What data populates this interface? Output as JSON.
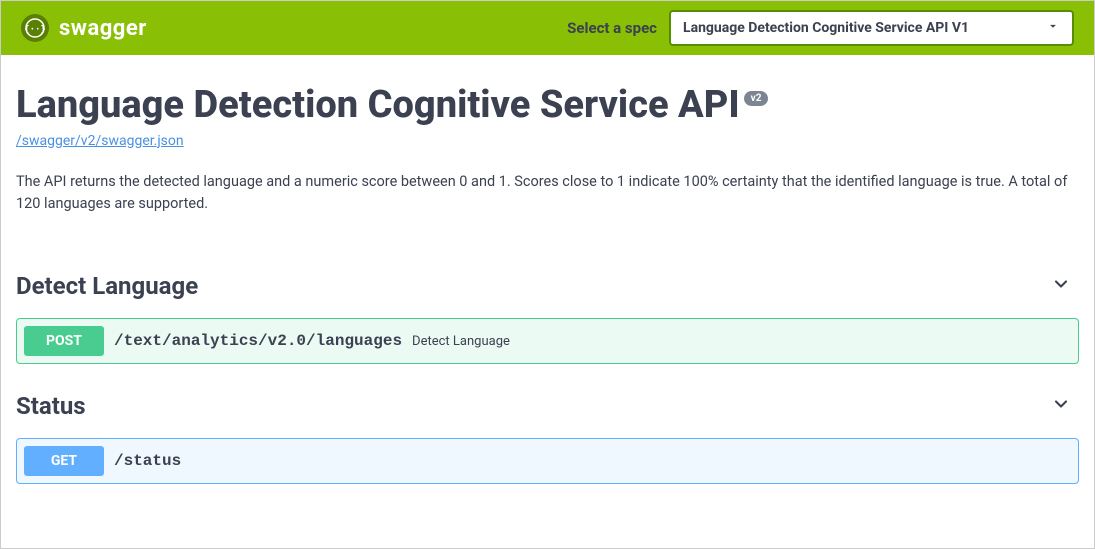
{
  "topbar": {
    "brand_text": "swagger",
    "select_label": "Select a spec",
    "selected_spec": "Language Detection Cognitive Service API V1"
  },
  "info": {
    "title": "Language Detection Cognitive Service API",
    "version": "v2",
    "spec_url": "/swagger/v2/swagger.json",
    "description": "The API returns the detected language and a numeric score between 0 and 1. Scores close to 1 indicate 100% certainty that the identified language is true. A total of 120 languages are supported."
  },
  "tags": {
    "detect": {
      "name": "Detect Language",
      "operations": {
        "post_languages": {
          "method": "POST",
          "path": "/text/analytics/v2.0/languages",
          "summary": "Detect Language"
        }
      }
    },
    "status": {
      "name": "Status",
      "operations": {
        "get_status": {
          "method": "GET",
          "path": "/status"
        }
      }
    }
  }
}
